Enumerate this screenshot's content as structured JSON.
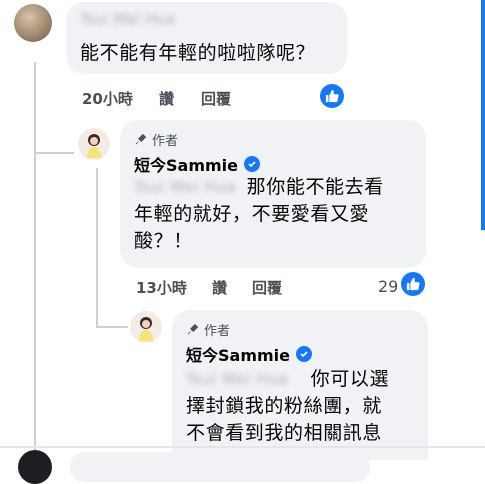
{
  "comments": [
    {
      "name": "Tsui Wei Hua",
      "text_lines": [
        "能不能有年輕的啦啦隊呢？"
      ],
      "time": "20小時",
      "like_label": "讚",
      "reply_label": "回覆",
      "reaction_count": ""
    },
    {
      "author_tag": "作者",
      "name": "短今Sammie",
      "mention": "Tsui Wei Hua",
      "text_lines": [
        "那你能不能去看",
        "年輕的就好，不要愛看又愛",
        "酸？！"
      ],
      "time": "13小時",
      "like_label": "讚",
      "reply_label": "回覆",
      "reaction_count": "29"
    },
    {
      "author_tag": "作者",
      "name": "短今Sammie",
      "mention": "Tsui Wei Hua",
      "text_lines": [
        "你可以選",
        "擇封鎖我的粉絲團，就",
        "不會看到我的相關訊息"
      ]
    }
  ],
  "colors": {
    "accent": "#1877f2",
    "bubble": "#f0f2f5"
  }
}
